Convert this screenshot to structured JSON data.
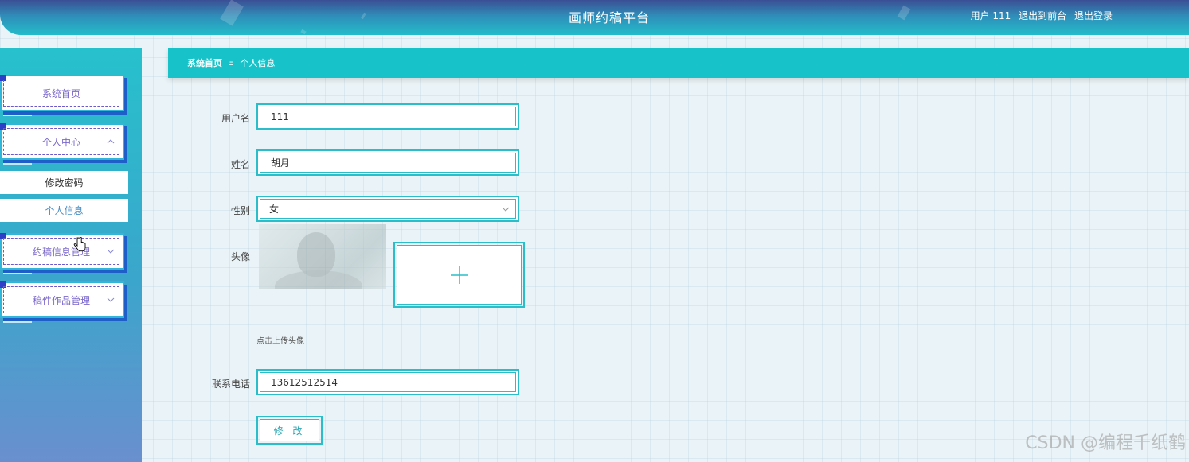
{
  "header": {
    "title": "画师约稿平台",
    "user_label": "用户 111",
    "front_link": "退出到前台",
    "logout_link": "退出登录"
  },
  "sidebar": {
    "items": [
      {
        "label": "系统首页"
      },
      {
        "label": "个人中心",
        "expanded": true,
        "children": [
          "修改密码",
          "个人信息"
        ]
      },
      {
        "label": "约稿信息管理"
      },
      {
        "label": "稿件作品管理"
      }
    ]
  },
  "breadcrumb": {
    "home": "系统首页",
    "separator": "Ξ",
    "current": "个人信息"
  },
  "form": {
    "username_label": "用户名",
    "username_value": "111",
    "name_label": "姓名",
    "name_value": "胡月",
    "gender_label": "性别",
    "gender_value": "女",
    "avatar_label": "头像",
    "upload_hint": "点击上传头像",
    "phone_label": "联系电话",
    "phone_value": "13612512514",
    "submit_label": "修 改"
  },
  "watermark": "CSDN @编程千纸鹤",
  "colors": {
    "accent": "#17c3c9",
    "menu_text": "#7b68c9",
    "menu_shadow": "#1e5ec9"
  }
}
